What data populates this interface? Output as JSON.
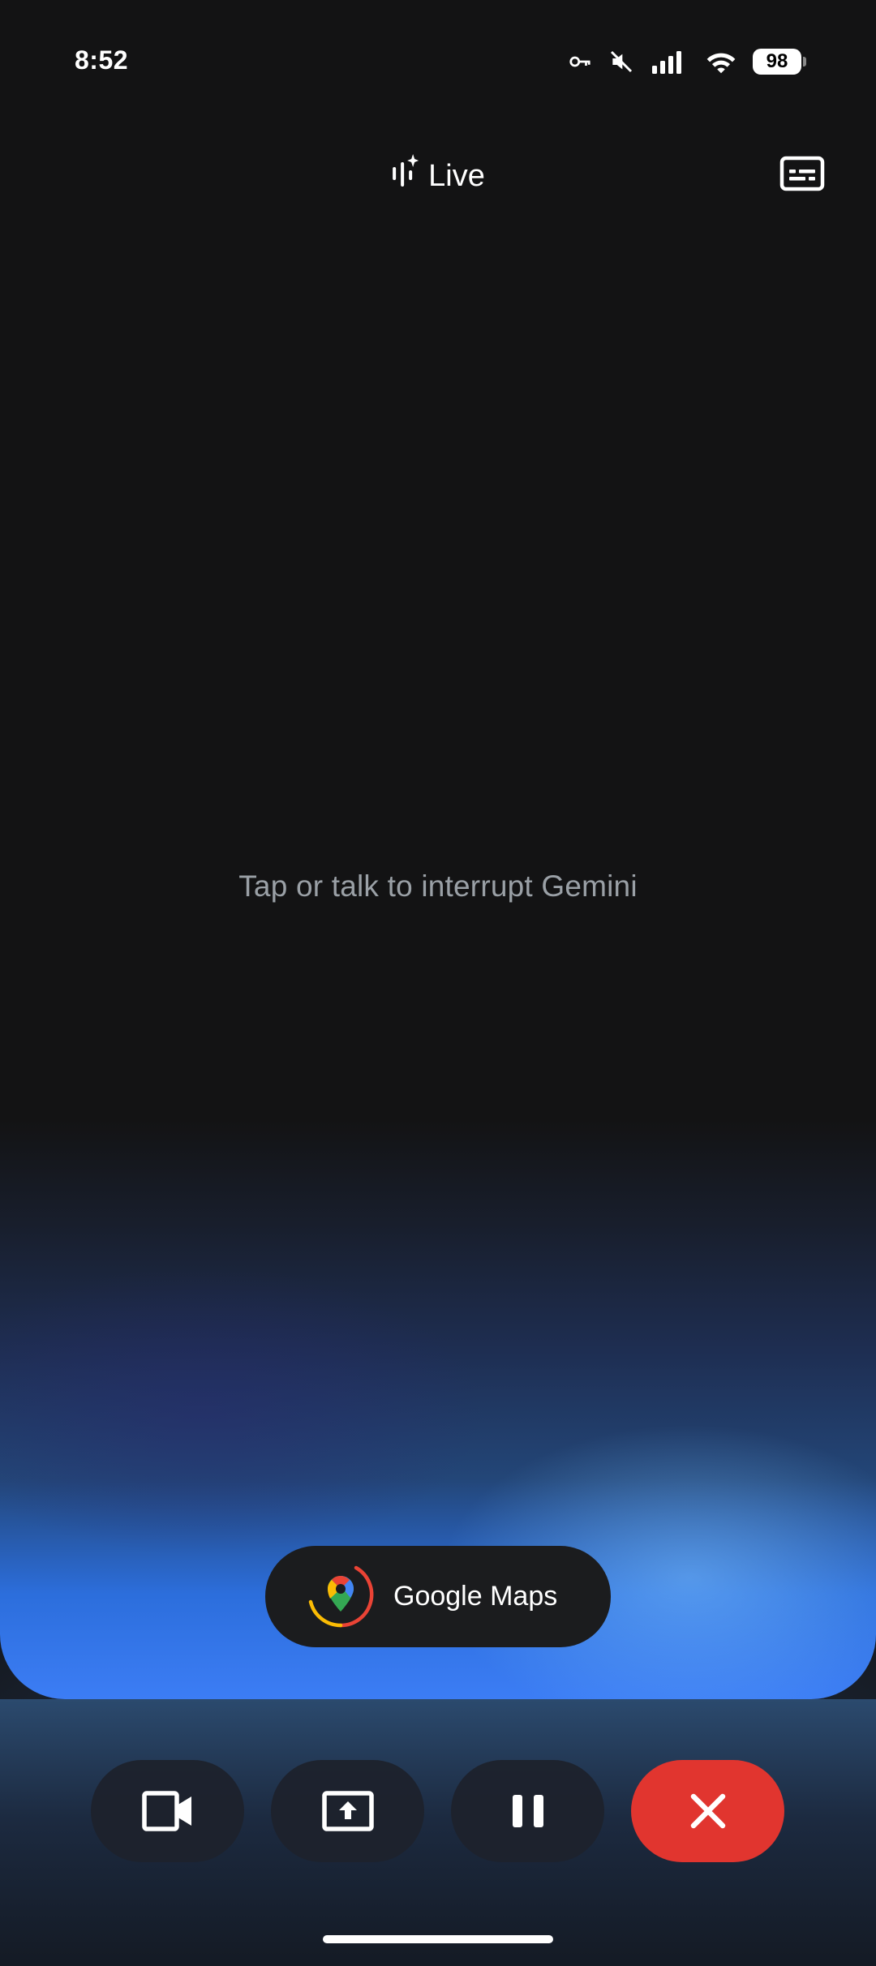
{
  "status_bar": {
    "time": "8:52",
    "battery_level": "98",
    "icons": [
      "vpn-key-icon",
      "mute-icon",
      "signal-icon",
      "wifi-icon",
      "battery-icon"
    ]
  },
  "header": {
    "title": "Live",
    "title_icon": "gemini-live-sparkle-icon",
    "captions_icon": "captions-icon"
  },
  "main": {
    "hint": "Tap or talk to interrupt Gemini"
  },
  "extension_chip": {
    "label": "Google Maps",
    "icon": "google-maps-icon"
  },
  "controls": [
    {
      "name": "camera",
      "icon": "video-camera-icon"
    },
    {
      "name": "share-screen",
      "icon": "screen-share-icon"
    },
    {
      "name": "pause",
      "icon": "pause-icon"
    },
    {
      "name": "end",
      "icon": "close-icon",
      "color": "#e1352f"
    }
  ],
  "colors": {
    "background": "#131314",
    "accent_blue": "#3c7df5",
    "end_red": "#e1352f",
    "hint_gray": "#9aa0a6"
  }
}
